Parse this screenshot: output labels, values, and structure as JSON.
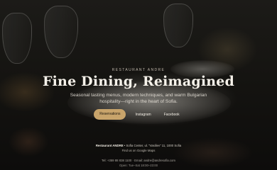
{
  "hero": {
    "eyebrow": "Restaurant Andre",
    "title": "Fine Dining, Reimagined",
    "subtitle": "Seasonal tasting menus, modern techniques, and warm Bulgarian hospitality—right in the heart of Sofia.",
    "buttons": {
      "reservations": "Reservations",
      "instagram": "Instagram",
      "facebook": "Facebook"
    }
  },
  "footer": {
    "name": "Restaurant ANDRE",
    "address": "• Sofia Center, ul. “Vasiliev” 11, 1000 Sofia",
    "maps_link": "Find us on Google Maps",
    "contact": "Tel: +359 88 838 1100 · Email: andre@andresofia.com",
    "hours": "Open: Tue–Sat 18:00–23:00"
  },
  "colors": {
    "accent": "#c8a46b",
    "text": "#f2ede4"
  }
}
